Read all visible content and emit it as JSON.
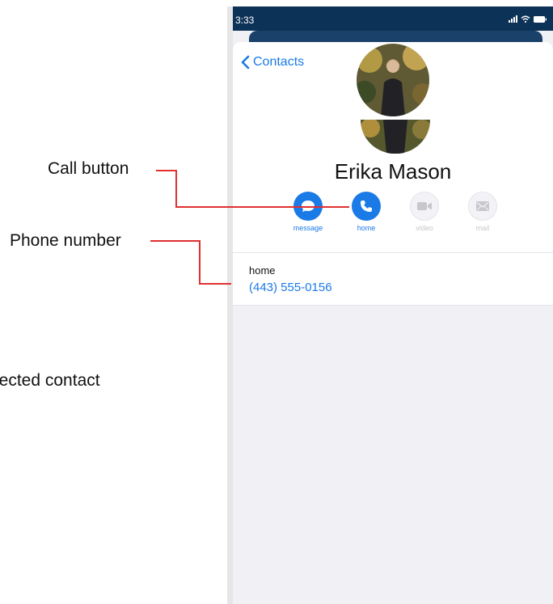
{
  "annotations": {
    "call_button": "Call button",
    "phone_number": "Phone number",
    "selected_contact": "lected contact"
  },
  "status_bar": {
    "time": "3:33"
  },
  "nav": {
    "back_label": "Contacts"
  },
  "contact": {
    "name": "Erika Mason"
  },
  "actions": [
    {
      "label": "message",
      "icon": "message-bubble-icon",
      "enabled": true
    },
    {
      "label": "home",
      "icon": "phone-icon",
      "enabled": true
    },
    {
      "label": "video",
      "icon": "video-camera-icon",
      "enabled": false
    },
    {
      "label": "mail",
      "icon": "envelope-icon",
      "enabled": false
    }
  ],
  "phone": {
    "label": "home",
    "number": "(443) 555-0156"
  },
  "colors": {
    "accent": "#1a7ae6",
    "status_bar": "#0d3257",
    "annotation_line": "#e03030",
    "disabled": "#c7c7cc"
  }
}
